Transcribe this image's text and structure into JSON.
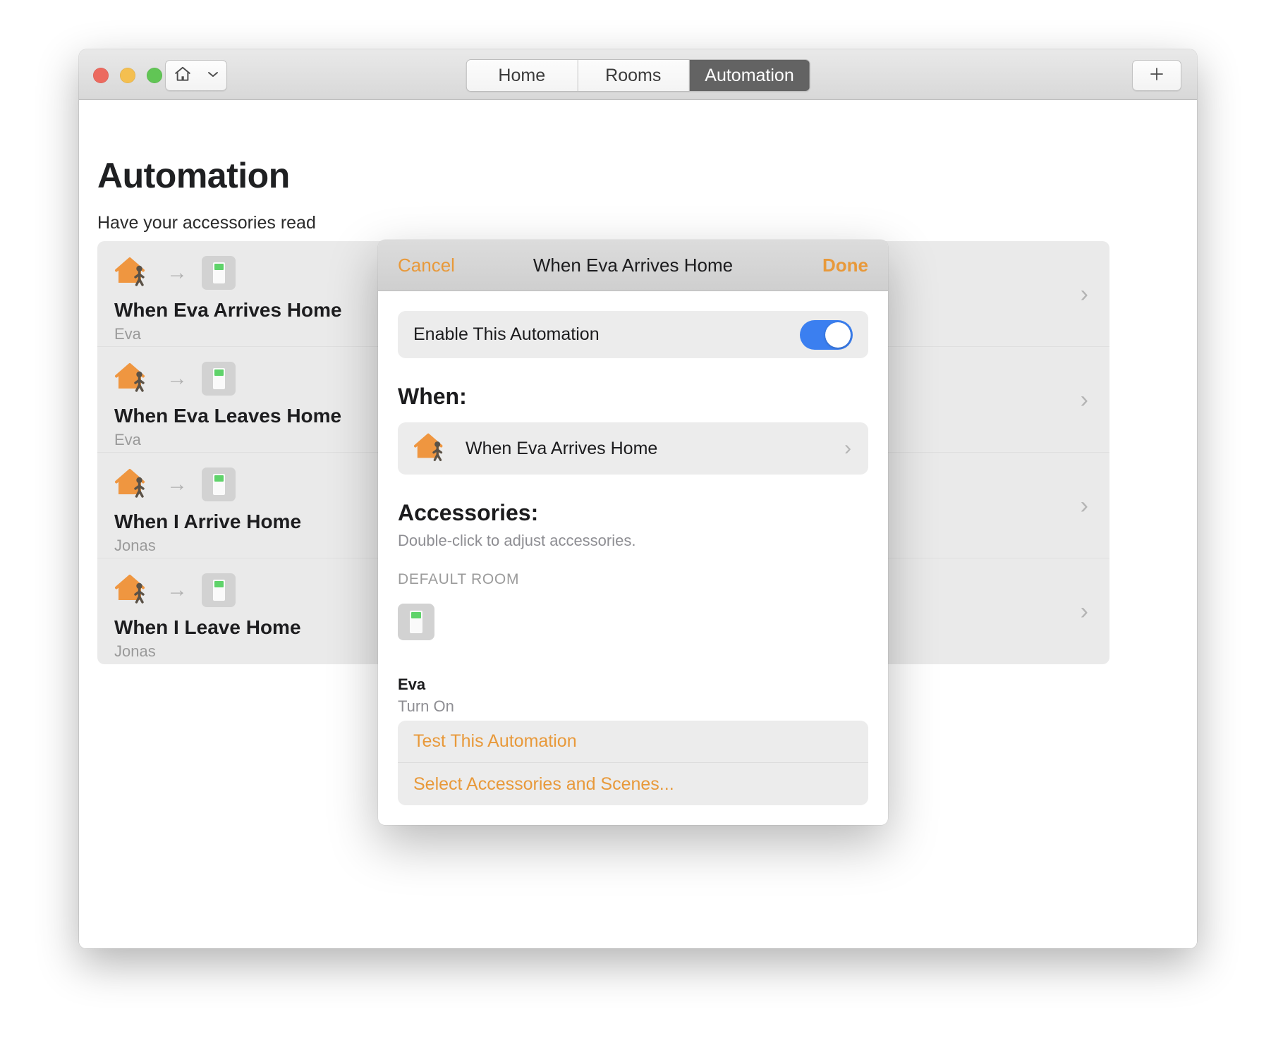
{
  "window": {
    "traffic_lights": [
      "close",
      "minimize",
      "zoom"
    ],
    "home_popup": {
      "icon": "house-icon",
      "chevron": "chevron-down-icon"
    },
    "add_button_label": "+",
    "tabs": [
      {
        "label": "Home",
        "active": false
      },
      {
        "label": "Rooms",
        "active": false
      },
      {
        "label": "Automation",
        "active": true
      }
    ]
  },
  "page": {
    "title": "Automation",
    "subtitle": "Have your accessories read",
    "automations": [
      {
        "title": "When Eva Arrives Home",
        "subtitle": "Eva",
        "trigger_icon": "house-arrive-icon",
        "arrow": "→",
        "accessory_icon": "light-switch-icon",
        "chevron": "›"
      },
      {
        "title": "When Eva Leaves Home",
        "subtitle": "Eva",
        "trigger_icon": "house-leave-icon",
        "arrow": "→",
        "accessory_icon": "light-switch-icon",
        "chevron": "›"
      },
      {
        "title": "When I Arrive Home",
        "subtitle": "Jonas",
        "trigger_icon": "house-arrive-icon",
        "arrow": "→",
        "accessory_icon": "light-switch-icon",
        "chevron": "›"
      },
      {
        "title": "When I Leave Home",
        "subtitle": "Jonas",
        "trigger_icon": "house-leave-icon",
        "arrow": "→",
        "accessory_icon": "light-switch-icon",
        "chevron": "›"
      }
    ]
  },
  "sheet": {
    "cancel_label": "Cancel",
    "title": "When Eva Arrives Home",
    "done_label": "Done",
    "enable": {
      "label": "Enable This Automation",
      "on": true
    },
    "when": {
      "heading": "When:",
      "item_label": "When Eva Arrives Home",
      "item_icon": "house-arrive-icon",
      "chevron": "›"
    },
    "accessories": {
      "heading": "Accessories:",
      "note": "Double-click to adjust accessories.",
      "room_label": "DEFAULT ROOM",
      "items": [
        {
          "name": "Eva",
          "state": "Turn On",
          "icon": "light-switch-icon"
        }
      ]
    },
    "actions": [
      {
        "label": "Test This Automation"
      },
      {
        "label": "Select Accessories and Scenes..."
      }
    ]
  },
  "colors": {
    "accent_orange": "#e8993a",
    "toggle_blue": "#3b7ff0",
    "active_tab_bg": "#636363",
    "switch_green": "#5fd36a",
    "house_orange": "#ef9640"
  }
}
